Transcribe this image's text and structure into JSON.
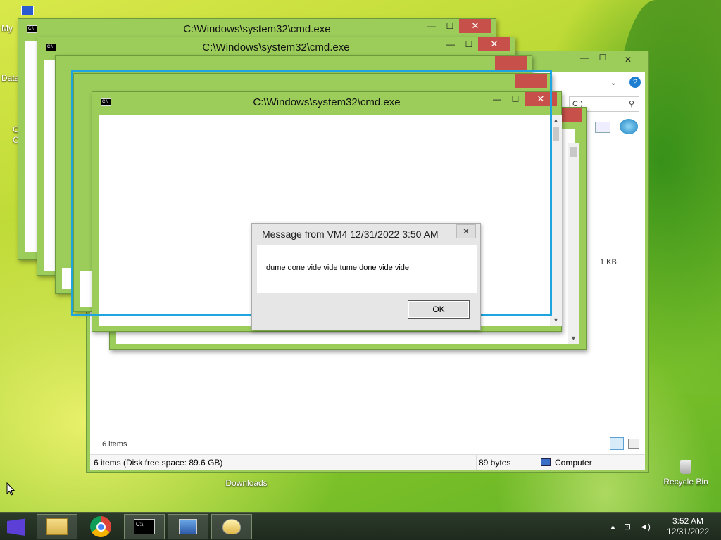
{
  "desktop": {
    "icons": [
      {
        "label": "Downloads"
      },
      {
        "label": "Recycle Bin"
      }
    ],
    "edge_labels": [
      "My",
      "Data",
      "C",
      "C"
    ]
  },
  "cmd_windows": [
    {
      "title": "C:\\Windows\\system32\\cmd.exe"
    },
    {
      "title": "C:\\Windows\\system32\\cmd.exe"
    },
    {
      "title": "C:\\Windows\\system32\\cmd.exe"
    }
  ],
  "window_controls": {
    "minimize": "—",
    "maximize": "☐",
    "close": "✕"
  },
  "explorer": {
    "search_text": "C:)",
    "file_size": "1 KB",
    "items_count": "6 items",
    "status_left": "6 items (Disk free space: 89.6 GB)",
    "status_mid": "89 bytes",
    "status_right": "Computer"
  },
  "message_box": {
    "title": "Message from VM4 12/31/2022 3:50 AM",
    "text": "dume done vide vide tume done vide vide",
    "ok_label": "OK",
    "close": "✕"
  },
  "taskbar": {
    "time": "3:52 AM",
    "date": "12/31/2022",
    "items": [
      "file-explorer",
      "chrome",
      "command-prompt",
      "remote-desktop",
      "messenger"
    ]
  },
  "colors": {
    "window_frame": "#9ccd5b",
    "close_button": "#c7504a",
    "selection": "#1ea4de",
    "taskbar": "#1e2a1d"
  }
}
